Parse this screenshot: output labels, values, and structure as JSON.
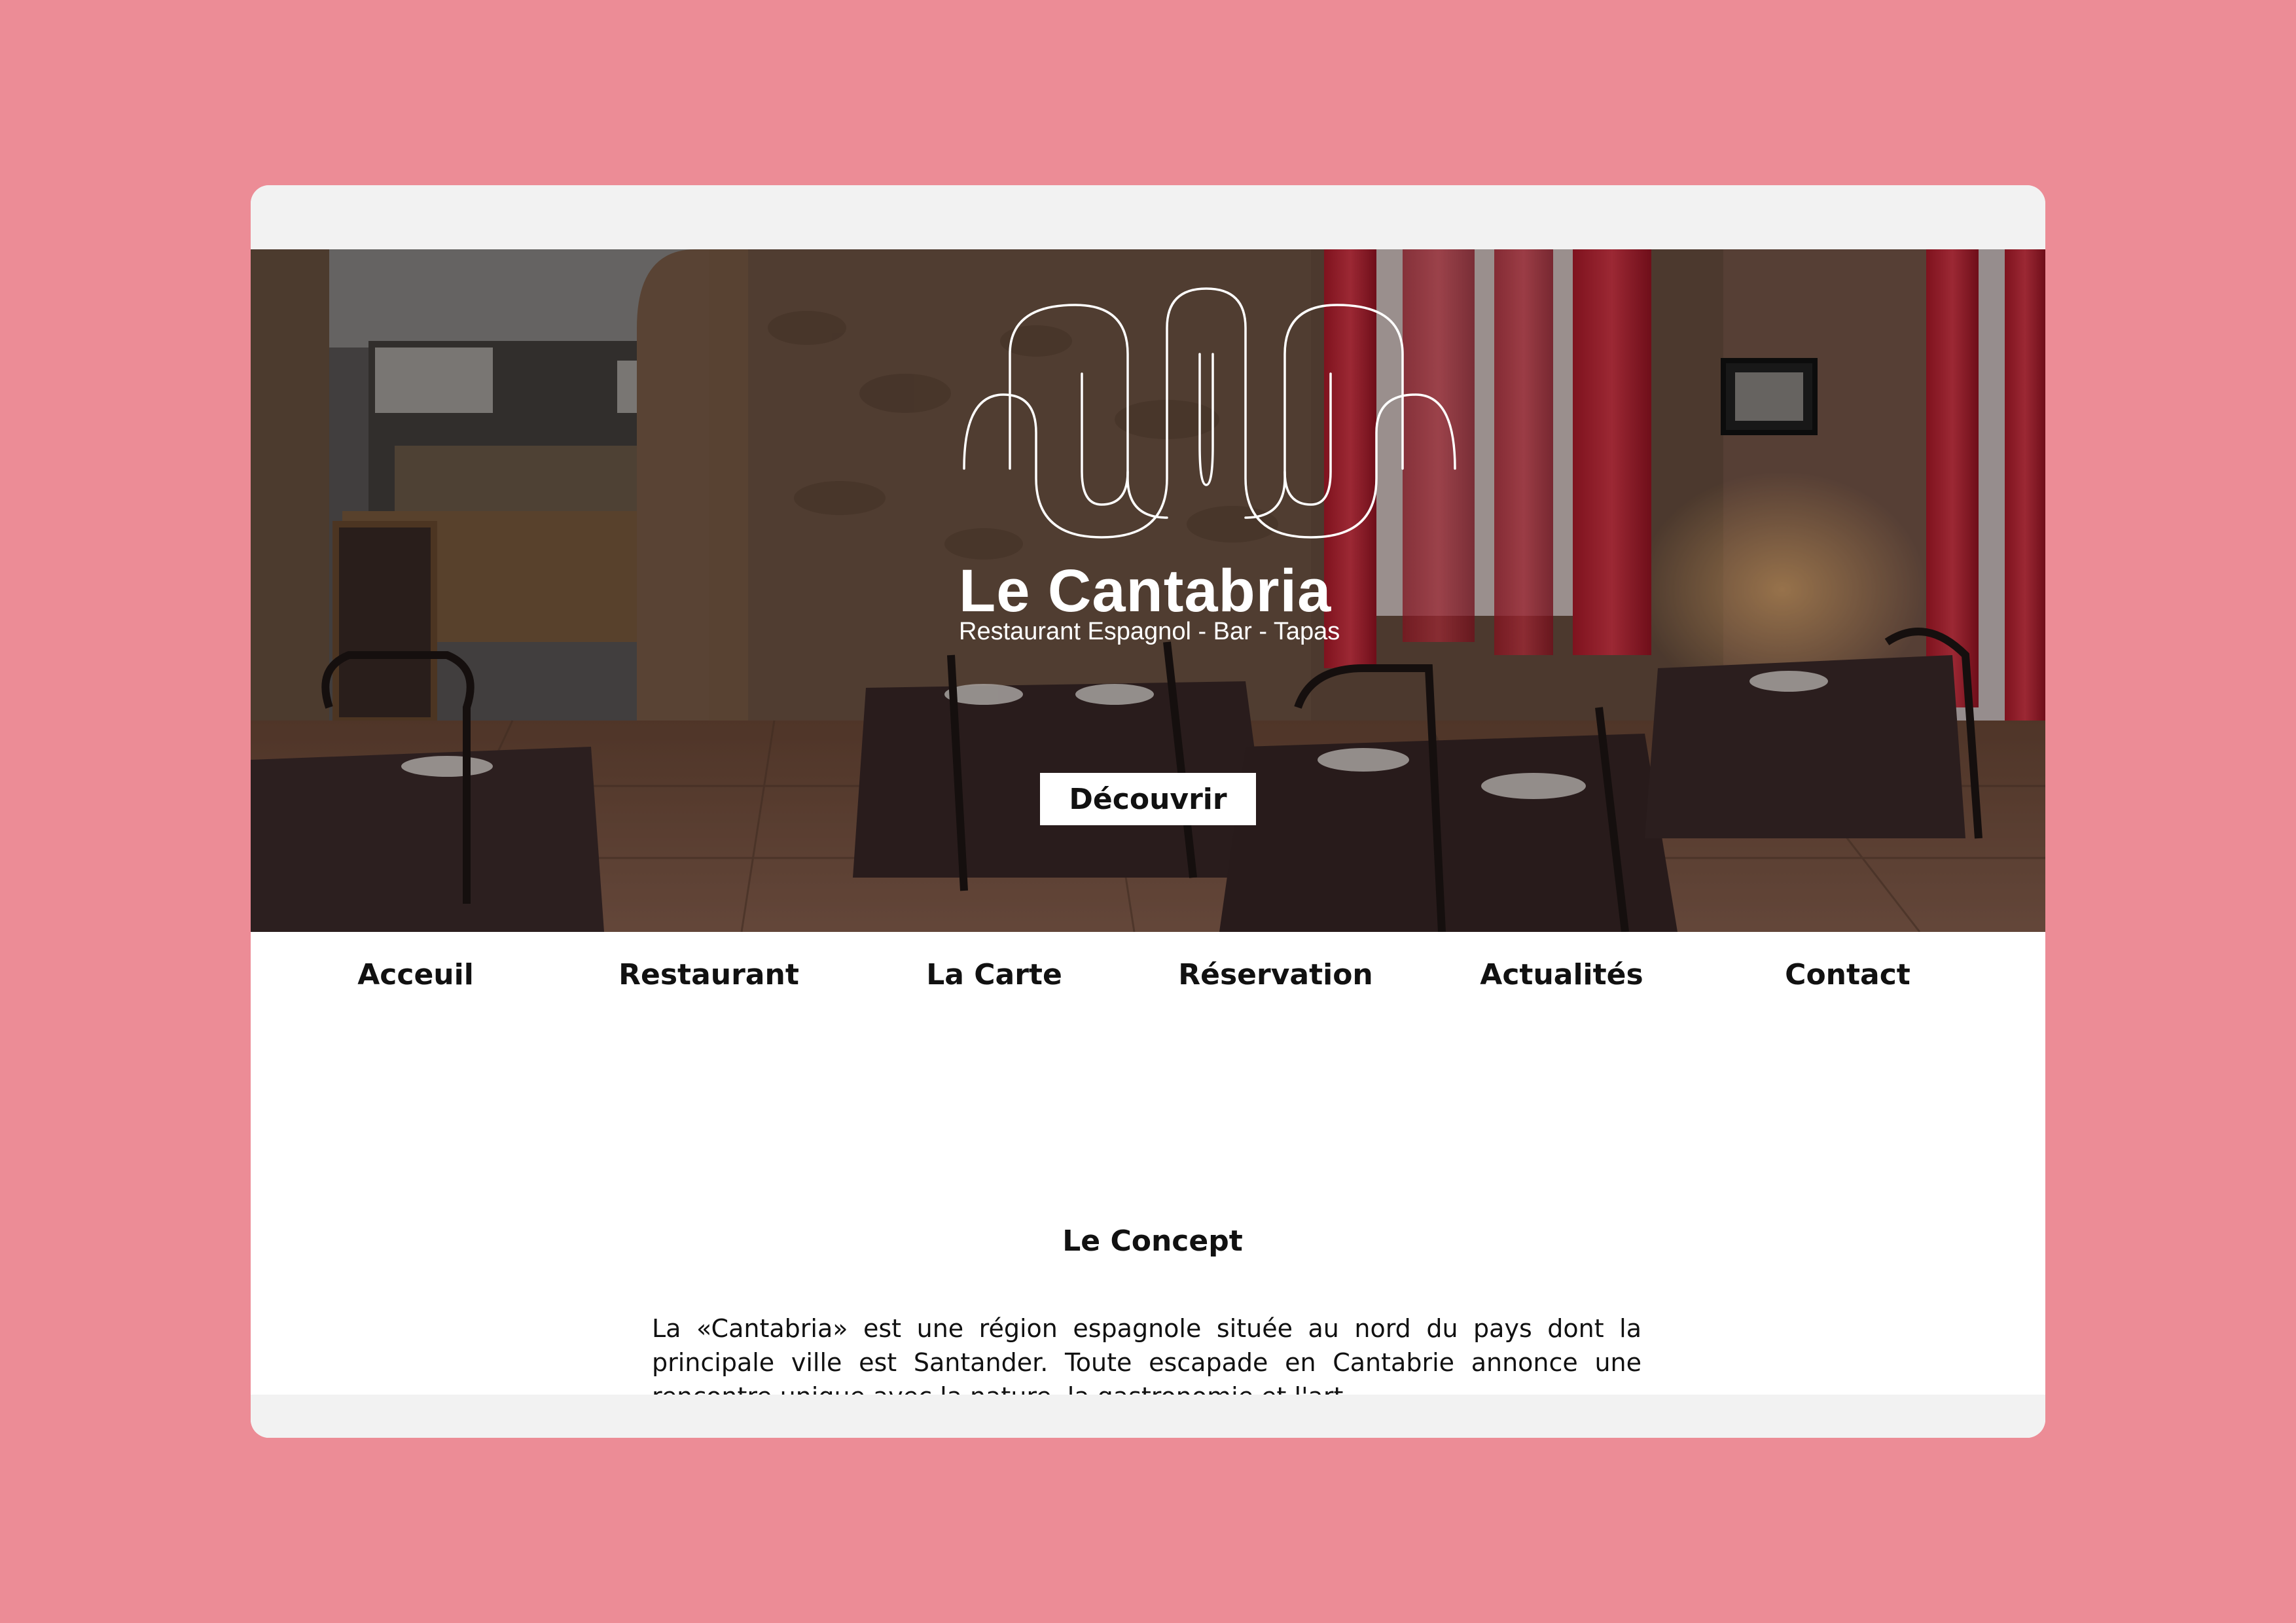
{
  "brand": {
    "name": "Le Cantabria",
    "tagline": "Restaurant Espagnol - Bar - Tapas"
  },
  "hero": {
    "cta_label": "Découvrir"
  },
  "nav": {
    "items": [
      {
        "label": "Acceuil"
      },
      {
        "label": "Restaurant"
      },
      {
        "label": "La Carte"
      },
      {
        "label": "Réservation"
      },
      {
        "label": "Actualités"
      },
      {
        "label": "Contact"
      }
    ]
  },
  "concept": {
    "title": "Le Concept",
    "text": "La «Cantabria» est une région espagnole située au nord du pays dont la principale ville est Santander. Toute escapade en Cantabrie annonce une rencontre unique avec la nature, la gastronomie et l'art."
  },
  "colors": {
    "background": "#ec8c96",
    "window": "#f2f2f2",
    "content": "#ffffff",
    "text": "#111111"
  }
}
